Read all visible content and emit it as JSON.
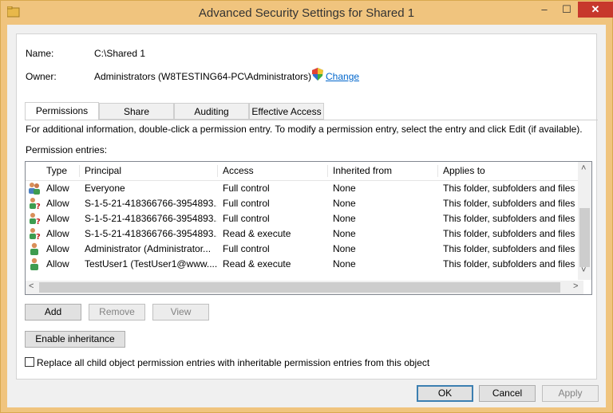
{
  "window": {
    "title": "Advanced Security Settings for Shared 1",
    "min_label": "–",
    "max_label": "☐",
    "close_label": "✕"
  },
  "fields": {
    "name_label": "Name:",
    "name_value": "C:\\Shared 1",
    "owner_label": "Owner:",
    "owner_value": "Administrators (W8TESTING64-PC\\Administrators)",
    "change_label": "Change"
  },
  "tabs": [
    {
      "label": "Permissions",
      "active": true
    },
    {
      "label": "Share",
      "active": false
    },
    {
      "label": "Auditing",
      "active": false
    },
    {
      "label": "Effective Access",
      "active": false
    }
  ],
  "info_text": "For additional information, double-click a permission entry. To modify a permission entry, select the entry and click Edit (if available).",
  "entries_label": "Permission entries:",
  "columns": [
    "Type",
    "Principal",
    "Access",
    "Inherited from",
    "Applies to"
  ],
  "rows": [
    {
      "icon": "group-icon",
      "type": "Allow",
      "principal": "Everyone",
      "access": "Full control",
      "inherited": "None",
      "applies": "This folder, subfolders and files"
    },
    {
      "icon": "unknown-user-icon",
      "type": "Allow",
      "principal": "S-1-5-21-418366766-3954893...",
      "access": "Full control",
      "inherited": "None",
      "applies": "This folder, subfolders and files"
    },
    {
      "icon": "unknown-user-icon",
      "type": "Allow",
      "principal": "S-1-5-21-418366766-3954893...",
      "access": "Full control",
      "inherited": "None",
      "applies": "This folder, subfolders and files"
    },
    {
      "icon": "unknown-user-icon",
      "type": "Allow",
      "principal": "S-1-5-21-418366766-3954893...",
      "access": "Read & execute",
      "inherited": "None",
      "applies": "This folder, subfolders and files"
    },
    {
      "icon": "user-icon",
      "type": "Allow",
      "principal": "Administrator (Administrator...",
      "access": "Full control",
      "inherited": "None",
      "applies": "This folder, subfolders and files"
    },
    {
      "icon": "user-icon",
      "type": "Allow",
      "principal": "TestUser1 (TestUser1@www....",
      "access": "Read & execute",
      "inherited": "None",
      "applies": "This folder, subfolders and files"
    }
  ],
  "buttons": {
    "add": "Add",
    "remove": "Remove",
    "view": "View",
    "enable_inheritance": "Enable inheritance",
    "replace_checkbox": "Replace all child object permission entries with inheritable permission entries from this object",
    "ok": "OK",
    "cancel": "Cancel",
    "apply": "Apply"
  },
  "colors": {
    "frame": "#f0c47e",
    "close": "#c7382c",
    "link": "#0066cc"
  }
}
